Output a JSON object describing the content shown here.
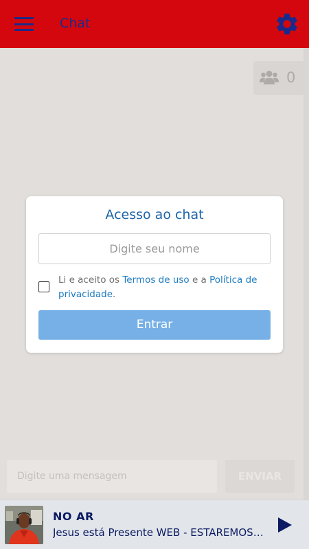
{
  "header": {
    "title": "Chat",
    "menu_icon": "hamburger-menu-icon",
    "settings_icon": "gear-icon",
    "bg_color": "#d4070f",
    "icon_color": "#1b2a8a"
  },
  "users": {
    "icon": "users-group-icon",
    "count": "0"
  },
  "modal": {
    "title": "Acesso ao chat",
    "name_placeholder": "Digite seu nome",
    "terms_prefix": "Li e aceito os ",
    "terms_link": "Termos de uso",
    "terms_middle": " e a ",
    "privacy_link": "Política de privacidade",
    "terms_suffix": ".",
    "checkbox_checked": false,
    "enter_label": "Entrar",
    "accent_color": "#1e64a8",
    "button_color": "#77b0e6"
  },
  "composer": {
    "message_placeholder": "Digite uma mensagem",
    "send_label": "ENVIAR"
  },
  "player": {
    "status": "NO AR",
    "track": "Jesus está Presente WEB - ESTAREMOS AO VIVO",
    "play_icon": "play-icon",
    "text_color": "#0c1a63"
  }
}
